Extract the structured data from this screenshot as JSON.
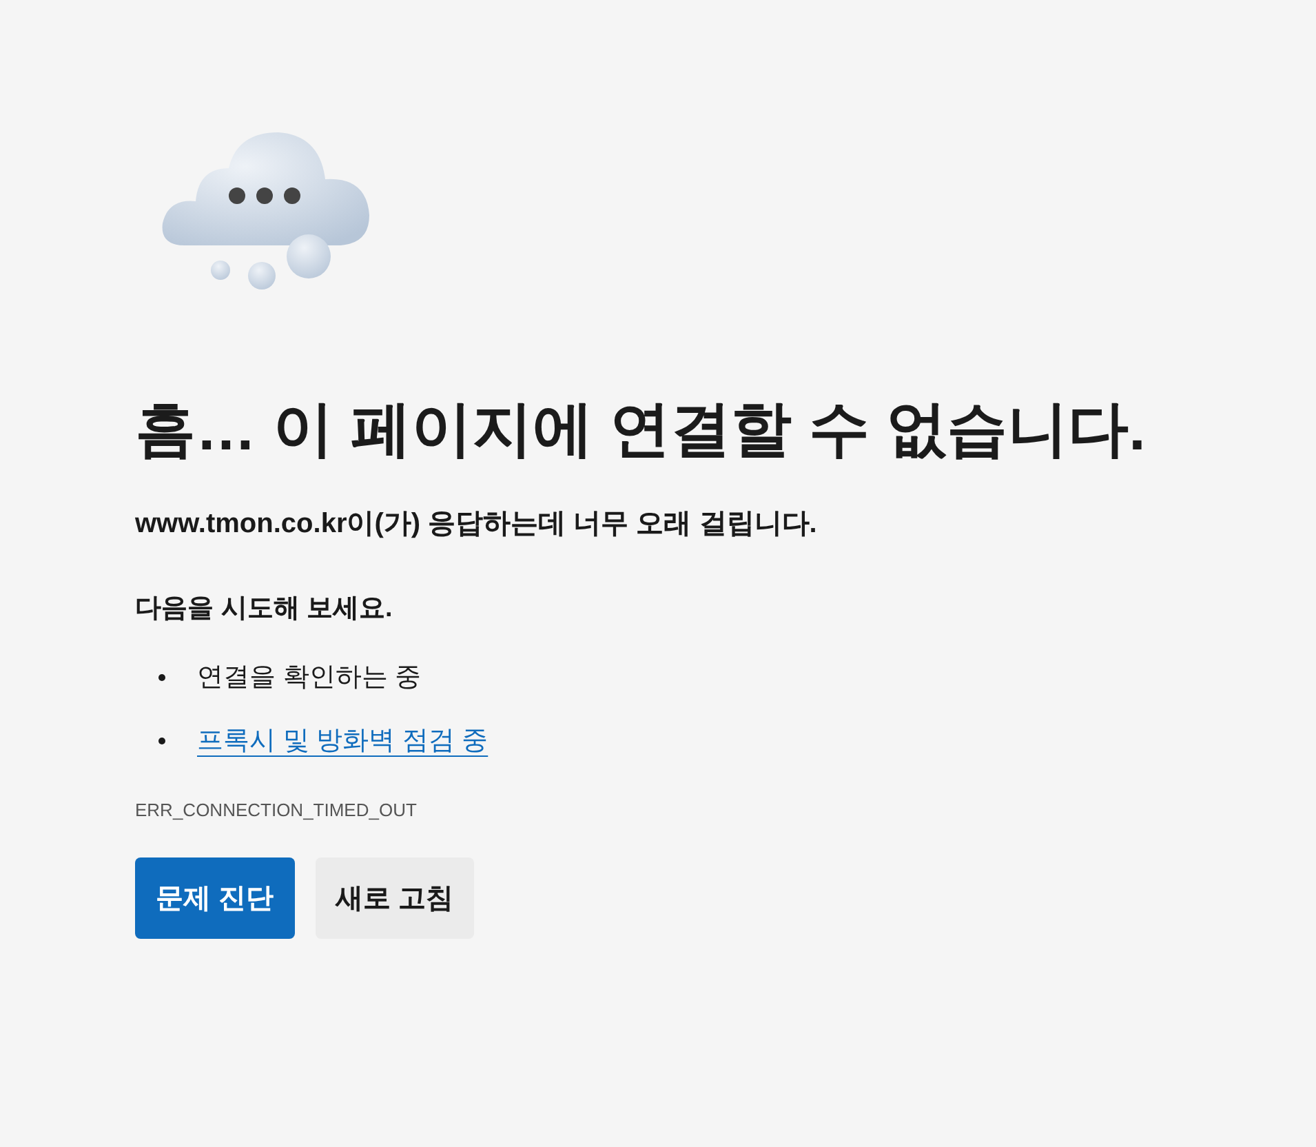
{
  "heading": "흠… 이 페이지에 연결할 수 없습니다.",
  "message": "www.tmon.co.kr이(가) 응답하는데 너무 오래 걸립니다.",
  "suggestions_title": "다음을 시도해 보세요.",
  "suggestions": [
    {
      "kind": "text",
      "label": "연결을 확인하는 중"
    },
    {
      "kind": "link",
      "label": "프록시 및 방화벽 점검 중"
    }
  ],
  "error_code": "ERR_CONNECTION_TIMED_OUT",
  "buttons": [
    {
      "kind": "primary",
      "label": "문제 진단"
    },
    {
      "kind": "secondary",
      "label": "새로 고침"
    }
  ]
}
